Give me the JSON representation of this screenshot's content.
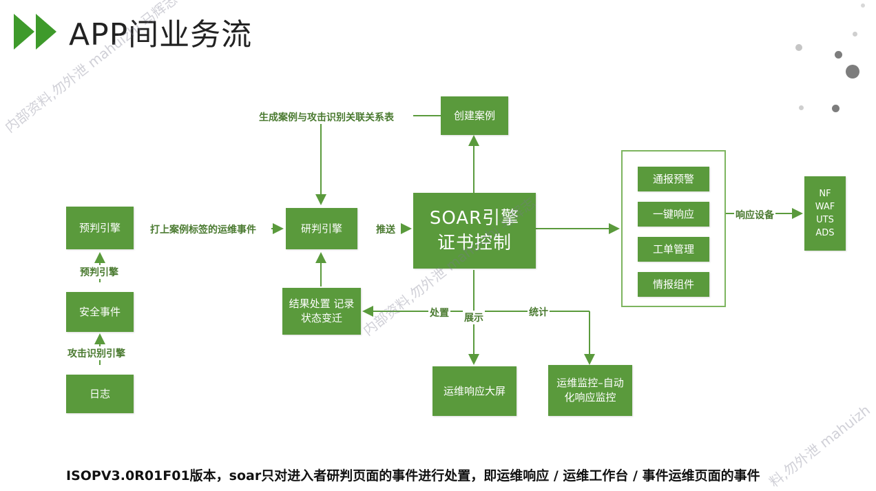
{
  "title": "APP间业务流",
  "boxes": {
    "prejudge": "预判引擎",
    "security_event": "安全事件",
    "log": "日志",
    "research": "研判引擎",
    "result": "结果处置 记录\n状态变迁",
    "soar": "SOAR引擎\n证书控制",
    "create_case": "创建案例",
    "ops_screen": "运维响应大屏",
    "ops_monitor": "运维监控–自动\n化响应监控",
    "notify": "通报预警",
    "one_click": "一键响应",
    "work_order": "工单管理",
    "intel": "情报组件",
    "devices": "NF\nWAF\nUTS\nADS"
  },
  "labels": {
    "gen_case_link": "生成案例与攻击识别关联关系表",
    "tag_events": "打上案例标签的运维事件",
    "prejudge_engine": "预判引擎",
    "attack_engine": "攻击识别引擎",
    "push": "推送",
    "dispose": "处置",
    "show": "展示",
    "stats": "统计",
    "response_device": "响应设备"
  },
  "watermarks": {
    "w1": "内部资料,勿外泄 mahuizhi 马辉志",
    "w2": "内部资料,勿外泄 mahuizhi 马辉志",
    "w3": "料,勿外泄 mahuizh"
  },
  "footer": "ISOPV3.0R01F01版本，soar只对进入者研判页面的事件进行处置，即运维响应 / 运维工作台 / 事件运维页面的事件",
  "colors": {
    "box": "#5a9a3c",
    "accent": "#3e9a2b",
    "line": "#5a9a3c"
  }
}
